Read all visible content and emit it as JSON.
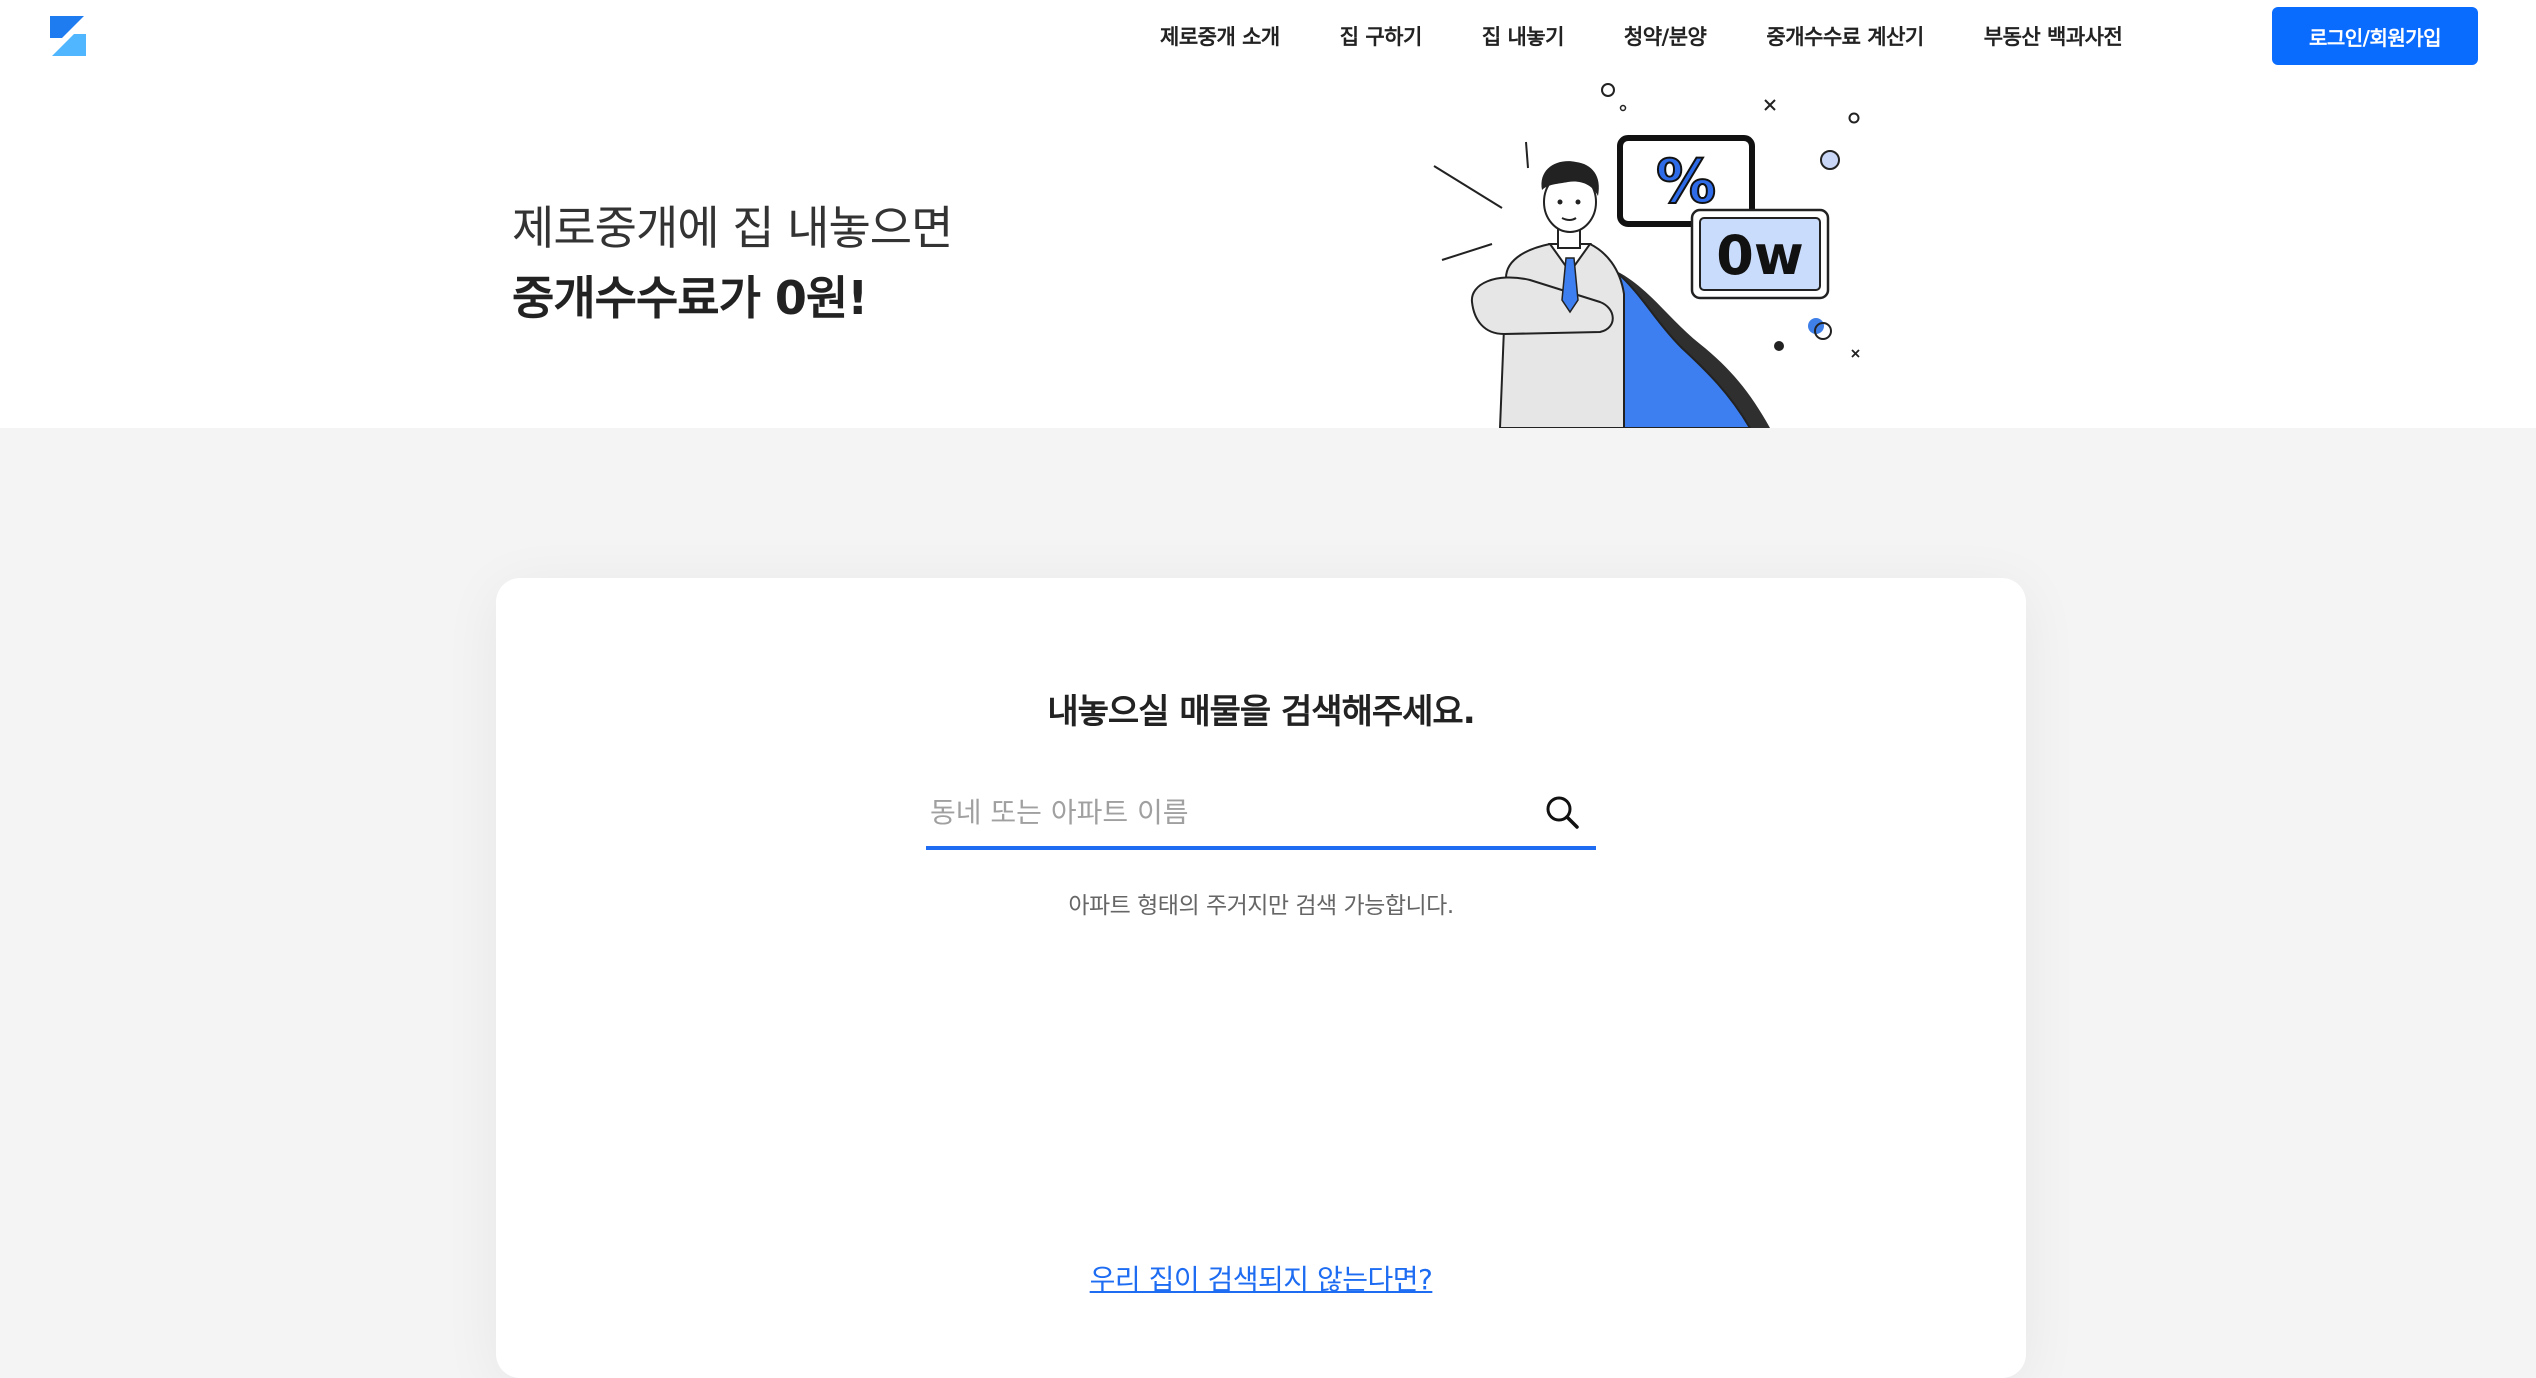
{
  "header": {
    "logo_icon": "zero-broker-logo-icon",
    "nav": [
      {
        "label": "제로중개 소개"
      },
      {
        "label": "집 구하기"
      },
      {
        "label": "집 내놓기"
      },
      {
        "label": "청약/분양"
      },
      {
        "label": "중개수수료 계산기"
      },
      {
        "label": "부동산 백과사전"
      }
    ],
    "login_label": "로그인/회원가입"
  },
  "hero": {
    "line1": "제로중개에 집 내놓으면",
    "line2": "중개수수료가 0원!",
    "illustration": {
      "percent_sign": "%",
      "zero_won": "0w"
    }
  },
  "search_card": {
    "title": "내놓으실 매물을 검색해주세요.",
    "search_placeholder": "동네 또는 아파트 이름",
    "search_value": "",
    "hint": "아파트 형태의 주거지만 검색 가능합니다.",
    "not_found_link": "우리 집이 검색되지 않는다면?"
  },
  "colors": {
    "accent": "#0a6bff",
    "underline": "#1d6cf2",
    "background": "#f4f4f4"
  }
}
